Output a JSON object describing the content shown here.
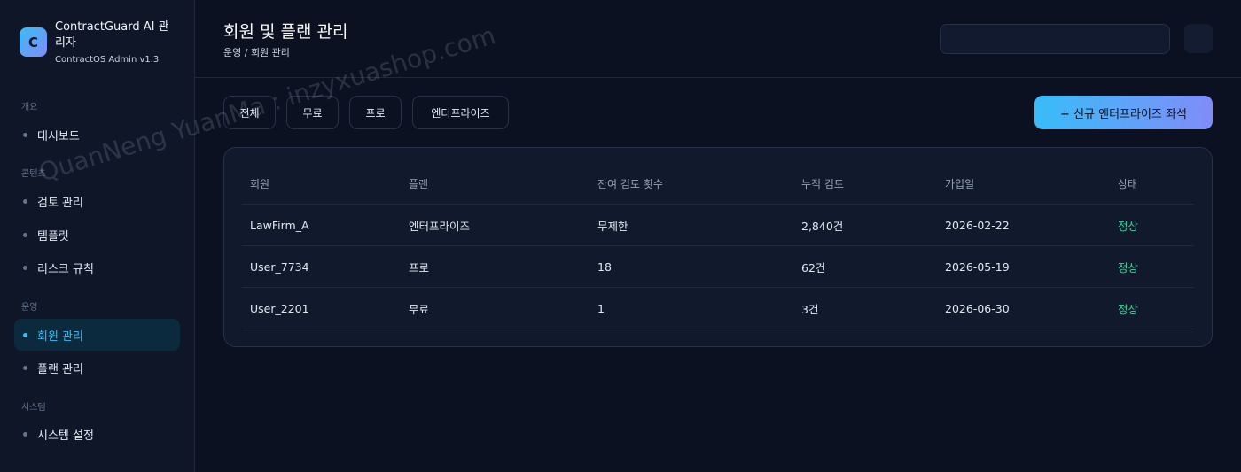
{
  "brand": {
    "logo_letter": "C",
    "name": "ContractGuard AI 관리자",
    "version": "ContractOS Admin v1.3"
  },
  "sidebar": {
    "sections": [
      {
        "label": "개요",
        "items": [
          {
            "label": "대시보드"
          }
        ]
      },
      {
        "label": "콘텐츠",
        "items": [
          {
            "label": "검토 관리"
          },
          {
            "label": "템플릿"
          },
          {
            "label": "리스크 규칙"
          }
        ]
      },
      {
        "label": "운영",
        "items": [
          {
            "label": "회원 관리",
            "active": true
          },
          {
            "label": "플랜 관리"
          }
        ]
      },
      {
        "label": "시스템",
        "items": [
          {
            "label": "시스템 설정"
          }
        ]
      }
    ]
  },
  "header": {
    "title": "회원 및 플랜 관리",
    "breadcrumb": "운영 / 회원 관리",
    "search_value": ""
  },
  "filters": [
    "전체",
    "무료",
    "프로",
    "엔터프라이즈"
  ],
  "primary_action": "+ 신규 엔터프라이즈 좌석",
  "table": {
    "columns": [
      "회원",
      "플랜",
      "잔여 검토 횟수",
      "누적 검토",
      "가입일",
      "상태"
    ],
    "rows": [
      [
        "LawFirm_A",
        "엔터프라이즈",
        "무제한",
        "2,840건",
        "2026-02-22",
        "정상"
      ],
      [
        "User_7734",
        "프로",
        "18",
        "62건",
        "2026-05-19",
        "정상"
      ],
      [
        "User_2201",
        "무료",
        "1",
        "3건",
        "2026-06-30",
        "정상"
      ]
    ]
  },
  "watermark": "QuanNeng YuanMa : inzyxuashop.com",
  "colors": {
    "accent": "#38bdf8",
    "accent2": "#818cf8",
    "status_ok": "#34d399",
    "bg": "#0b1120"
  }
}
